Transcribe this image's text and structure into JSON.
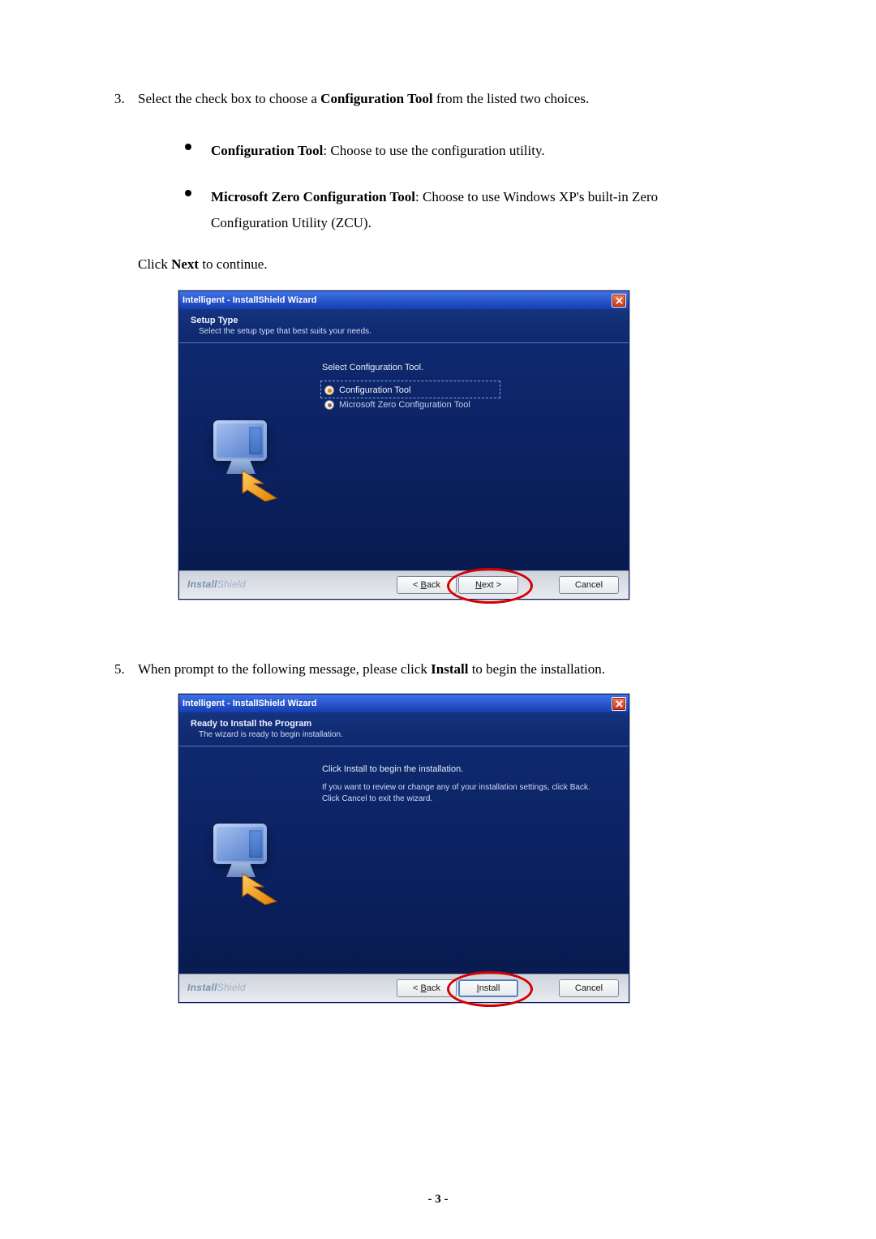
{
  "step3": {
    "number": "3.",
    "text_a": "Select the check box to choose a ",
    "text_bold": "Configuration Tool",
    "text_b": " from the listed two choices."
  },
  "bullets": {
    "config": {
      "title": "Configuration Tool",
      "desc": ": Choose to use the configuration utility."
    },
    "ms": {
      "title": "Microsoft Zero Configuration Tool",
      "desc": ": Choose to use Windows XP's built-in Zero Configuration Utility (ZCU)."
    }
  },
  "click_next": {
    "a": "Click ",
    "b": "Next",
    "c": " to continue."
  },
  "wizard1": {
    "title": "Intelligent - InstallShield Wizard",
    "heading": "Setup Type",
    "subheading": "Select the setup type that best suits your needs.",
    "select_label": "Select Configuration Tool.",
    "radio_config": "Configuration Tool",
    "radio_ms": "Microsoft Zero Configuration Tool",
    "brand1": "Install",
    "brand2": "Shield",
    "back": "< Back",
    "next": "Next >",
    "next_ul": "N",
    "back_ul": "B",
    "cancel": "Cancel"
  },
  "step5": {
    "number": "5.",
    "text_a": "When prompt to the following message, please click ",
    "text_bold": "Install",
    "text_b": " to begin the installation."
  },
  "wizard2": {
    "title": "Intelligent - InstallShield Wizard",
    "heading": "Ready to Install the Program",
    "subheading": "The wizard is ready to begin installation.",
    "line1": "Click Install to begin the installation.",
    "line2": "If you want to review or change any of your installation settings, click Back. Click Cancel to exit the wizard.",
    "brand1": "Install",
    "brand2": "Shield",
    "back": "< Back",
    "install": "Install",
    "install_ul": "I",
    "back_ul": "B",
    "cancel": "Cancel"
  },
  "page_number": "- 3 -"
}
